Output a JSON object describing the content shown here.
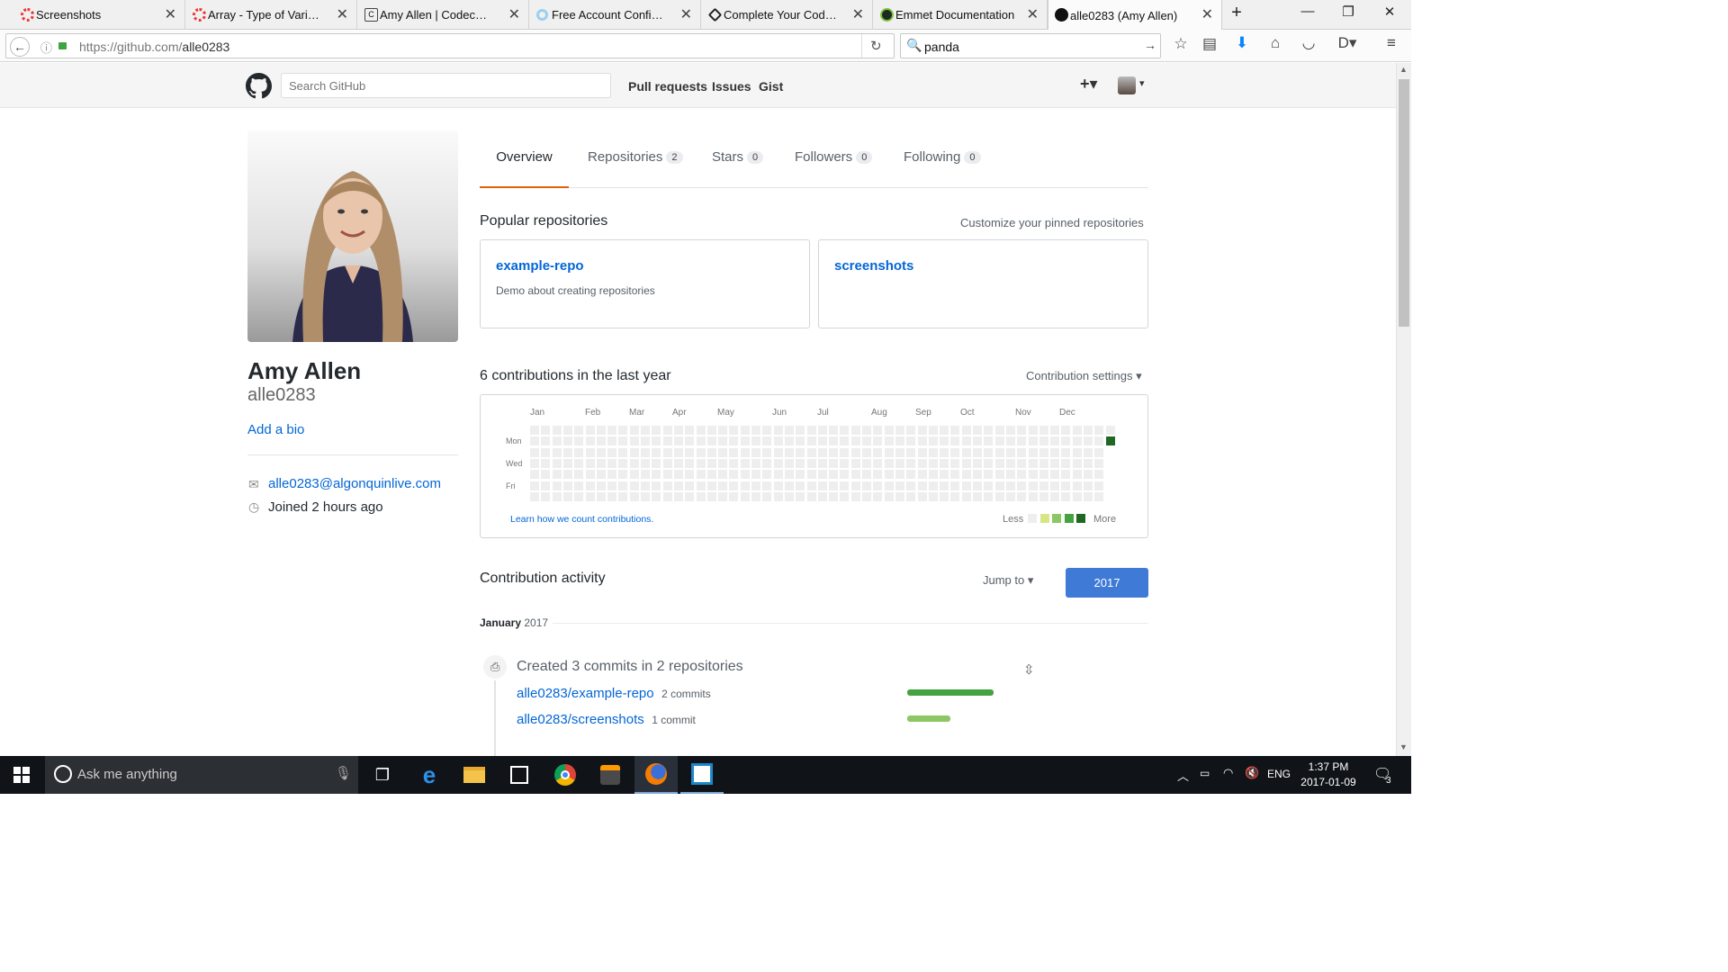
{
  "browser": {
    "tabs": [
      {
        "label": "Screenshots",
        "fav": "#e33",
        "x": 0
      },
      {
        "label": "Array - Type of Varia...",
        "fav": "#e33",
        "x": 0
      },
      {
        "label": "Amy Allen | Codecad...",
        "fav": "#333",
        "x": 0
      },
      {
        "label": "Free Account Confirm...",
        "fav": "#3a9fd8",
        "x": 0
      },
      {
        "label": "Complete Your Code...",
        "fav": "#222",
        "x": 0
      },
      {
        "label": "Emmet Documentation",
        "fav": "#333",
        "x": 0
      },
      {
        "label": "alle0283 (Amy Allen)",
        "fav": "#111",
        "x": 0
      }
    ],
    "new_tab": "+",
    "url_host": "https://github.com/",
    "url_path": "alle0283",
    "search_value": "panda"
  },
  "github": {
    "search_placeholder": "Search GitHub",
    "nav": {
      "pulls": "Pull requests",
      "issues": "Issues",
      "gist": "Gist"
    },
    "plus": "+▾"
  },
  "profile": {
    "fullname": "Amy Allen",
    "username": "alle0283",
    "add_bio": "Add a bio",
    "email": "alle0283@algonquinlive.com",
    "joined": "Joined 2 hours ago"
  },
  "tabs": {
    "overview": "Overview",
    "repositories": "Repositories",
    "repositories_count": "2",
    "stars": "Stars",
    "stars_count": "0",
    "followers": "Followers",
    "followers_count": "0",
    "following": "Following",
    "following_count": "0"
  },
  "popular": {
    "heading": "Popular repositories",
    "customize": "Customize your pinned repositories",
    "repos": [
      {
        "name": "example-repo",
        "desc": "Demo about creating repositories"
      },
      {
        "name": "screenshots",
        "desc": ""
      }
    ]
  },
  "contributions": {
    "heading": "6 contributions in the last year",
    "settings": "Contribution settings ▾",
    "months": [
      "Jan",
      "Feb",
      "Mar",
      "Apr",
      "May",
      "Jun",
      "Jul",
      "Aug",
      "Sep",
      "Oct",
      "Nov",
      "Dec"
    ],
    "days": [
      "Mon",
      "Wed",
      "Fri"
    ],
    "learn": "Learn how we count contributions.",
    "less": "Less",
    "more": "More",
    "legend_colors": [
      "#eeeeee",
      "#d6e685",
      "#8cc665",
      "#44a340",
      "#1e6823"
    ],
    "active_color": "#1e6823"
  },
  "activity": {
    "heading": "Contribution activity",
    "jump": "Jump to ▾",
    "year": "2017",
    "month": "January",
    "month_year": "2017",
    "summary": "Created 3 commits in 2 repositories",
    "items": [
      {
        "repo": "alle0283/example-repo",
        "count": "2 commits",
        "fraction": 1.0,
        "color": "#44a340"
      },
      {
        "repo": "alle0283/screenshots",
        "count": "1 commit",
        "fraction": 0.5,
        "color": "#8cc665"
      }
    ]
  },
  "taskbar": {
    "search": "Ask me anything",
    "lang": "ENG",
    "time": "1:37 PM",
    "date": "2017-01-09",
    "notif_count": "3"
  }
}
